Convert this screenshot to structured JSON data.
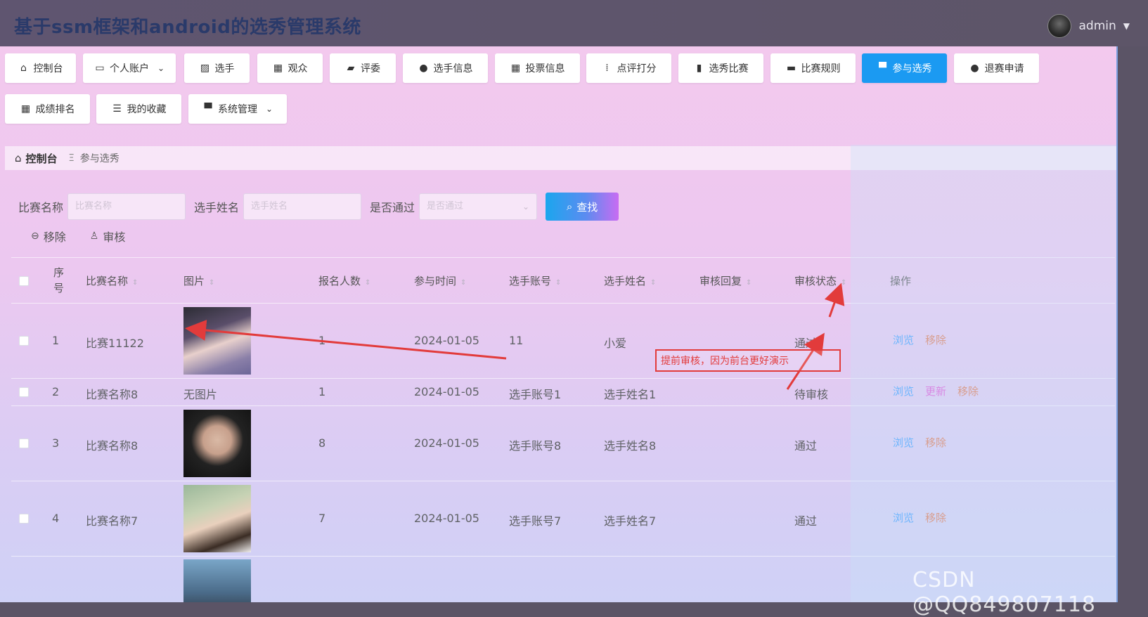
{
  "header": {
    "title": "基于ssm框架和android的选秀管理系统",
    "user": "admin"
  },
  "nav": [
    {
      "label": "控制台",
      "icon": "home-icon",
      "glyph": "⌂",
      "dropdown": false,
      "active": false
    },
    {
      "label": "个人账户",
      "icon": "card-icon",
      "glyph": "▭",
      "dropdown": true,
      "active": false
    },
    {
      "label": "选手",
      "icon": "chart-icon",
      "glyph": "▨",
      "dropdown": false,
      "active": false
    },
    {
      "label": "观众",
      "icon": "grid-icon",
      "glyph": "▦",
      "dropdown": false,
      "active": false
    },
    {
      "label": "评委",
      "icon": "wallet-icon",
      "glyph": "▰",
      "dropdown": false,
      "active": false
    },
    {
      "label": "选手信息",
      "icon": "user-icon",
      "glyph": "●",
      "dropdown": false,
      "active": false
    },
    {
      "label": "投票信息",
      "icon": "grid-icon",
      "glyph": "▦",
      "dropdown": false,
      "active": false
    },
    {
      "label": "点评打分",
      "icon": "apps-icon",
      "glyph": "⁞",
      "dropdown": false,
      "active": false
    },
    {
      "label": "选秀比赛",
      "icon": "bar-chart-icon",
      "glyph": "▮",
      "dropdown": false,
      "active": false
    },
    {
      "label": "比赛规则",
      "icon": "briefcase-icon",
      "glyph": "▬",
      "dropdown": false,
      "active": false
    },
    {
      "label": "参与选秀",
      "icon": "monitor-icon",
      "glyph": "▀",
      "dropdown": false,
      "active": true
    },
    {
      "label": "退赛申请",
      "icon": "pin-icon",
      "glyph": "●",
      "dropdown": false,
      "active": false
    },
    {
      "label": "成绩排名",
      "icon": "grid-icon",
      "glyph": "▦",
      "dropdown": false,
      "active": false
    },
    {
      "label": "我的收藏",
      "icon": "sliders-icon",
      "glyph": "☰",
      "dropdown": false,
      "active": false
    },
    {
      "label": "系统管理",
      "icon": "monitor-icon",
      "glyph": "▀",
      "dropdown": true,
      "active": false
    }
  ],
  "breadcrumb": {
    "home": "控制台",
    "separator": "Ξ",
    "current": "参与选秀"
  },
  "search": {
    "competition_label": "比赛名称",
    "competition_placeholder": "比赛名称",
    "player_label": "选手姓名",
    "player_placeholder": "选手姓名",
    "approved_label": "是否通过",
    "approved_placeholder": "是否通过",
    "find_label": "查找"
  },
  "actions": {
    "remove": "移除",
    "review": "审核"
  },
  "table": {
    "columns": [
      "序号",
      "比赛名称",
      "图片",
      "报名人数",
      "参与时间",
      "选手账号",
      "选手姓名",
      "审核回复",
      "审核状态",
      "操作"
    ],
    "rows": [
      {
        "index": "1",
        "name": "比赛11122",
        "image": "photo",
        "count": "1",
        "time": "2024-01-05",
        "account": "11",
        "player": "小爱",
        "reply": "",
        "status": "通过",
        "ops": [
          "浏览",
          "移除"
        ]
      },
      {
        "index": "2",
        "name": "比赛名称8",
        "image": "无图片",
        "count": "1",
        "time": "2024-01-05",
        "account": "选手账号1",
        "player": "选手姓名1",
        "reply": "",
        "status": "待审核",
        "ops": [
          "浏览",
          "更新",
          "移除"
        ]
      },
      {
        "index": "3",
        "name": "比赛名称8",
        "image": "photo",
        "count": "8",
        "time": "2024-01-05",
        "account": "选手账号8",
        "player": "选手姓名8",
        "reply": "",
        "status": "通过",
        "ops": [
          "浏览",
          "移除"
        ]
      },
      {
        "index": "4",
        "name": "比赛名称7",
        "image": "photo",
        "count": "7",
        "time": "2024-01-05",
        "account": "选手账号7",
        "player": "选手姓名7",
        "reply": "",
        "status": "通过",
        "ops": [
          "浏览",
          "移除"
        ]
      }
    ]
  },
  "annotation": {
    "text": "提前审核，因为前台更好演示",
    "color": "#e23b3b"
  },
  "watermark": "CSDN @QQ849807118"
}
